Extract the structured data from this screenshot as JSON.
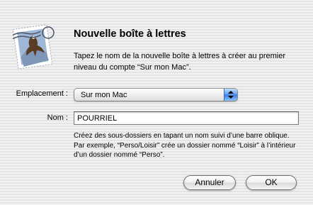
{
  "dialog": {
    "icon": "mail-stamp-eagle-icon",
    "title": "Nouvelle boîte à lettres",
    "message": "Tapez le nom de la nouvelle boîte à lettres à créer au premier niveau du compte “Sur mon Mac”.",
    "location": {
      "label": "Emplacement :",
      "selected": "Sur mon Mac",
      "arrows_icon": "popup-arrows-icon"
    },
    "name_field": {
      "label": "Nom :",
      "value": "POURRIEL"
    },
    "hint": "Créez des sous-dossiers en tapant un nom suivi d’une barre oblique. Par exemple, “Perso/Loisir” crée un dossier nommé “Loisir” à l’intérieur d’un dossier nommé “Perso”.",
    "buttons": {
      "cancel": "Annuler",
      "ok": "OK"
    },
    "colors": {
      "accent": "#3a79de",
      "background": "#ececec"
    }
  }
}
